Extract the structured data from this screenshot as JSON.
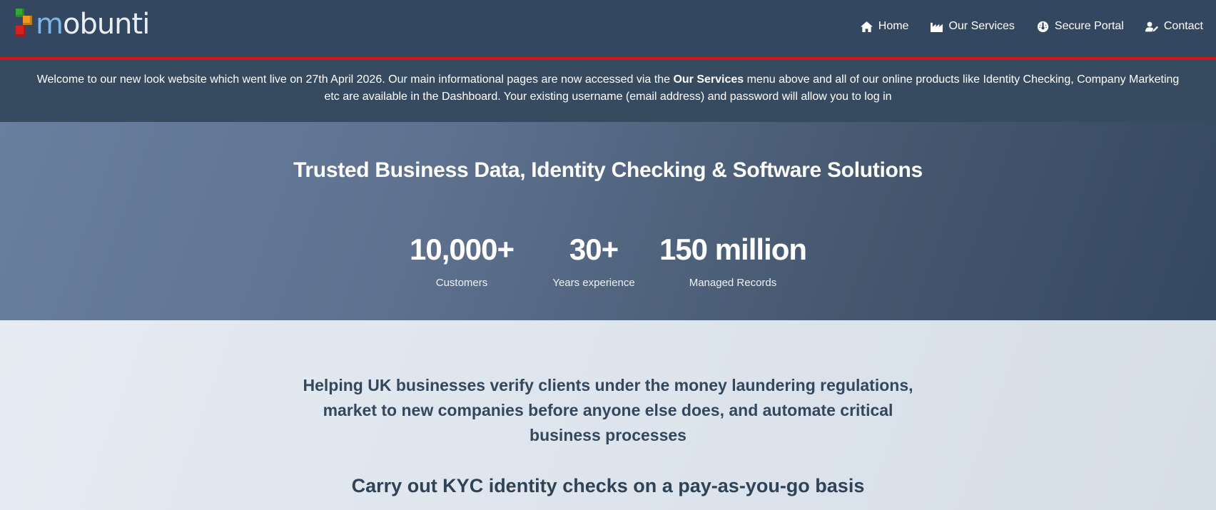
{
  "brand": {
    "logo_first": "m",
    "logo_rest": "obunti",
    "colors": {
      "header": "#334860",
      "accent": "#d4151b",
      "hero_start": "#697f9f",
      "hero_end": "#344860"
    }
  },
  "nav": {
    "items": [
      {
        "label": "Home",
        "icon": "home-icon"
      },
      {
        "label": "Our Services",
        "icon": "factory-icon"
      },
      {
        "label": "Secure Portal",
        "icon": "dashboard-icon"
      },
      {
        "label": "Contact",
        "icon": "user-edit-icon"
      }
    ]
  },
  "notice": {
    "before": "Welcome to our new look website which went live on 27th April 2026. Our main informational pages are now accessed via the ",
    "bold": "Our Services",
    "after": " menu above and all of our online products like Identity Checking, Company Marketing etc are available in the Dashboard. Your existing username (email address) and password will allow you to log in"
  },
  "hero": {
    "title": "Trusted Business Data, Identity Checking & Software Solutions",
    "stats": [
      {
        "value": "10,000+",
        "label": "Customers"
      },
      {
        "value": "30+",
        "label": "Years experience"
      },
      {
        "value": "150 million",
        "label": "Managed Records"
      }
    ]
  },
  "content": {
    "lead": "Helping UK businesses verify clients under the money laundering regulations, market to new companies before anyone else does, and automate critical business processes",
    "subheading": "Carry out KYC identity checks on a pay-as-you-go basis"
  }
}
